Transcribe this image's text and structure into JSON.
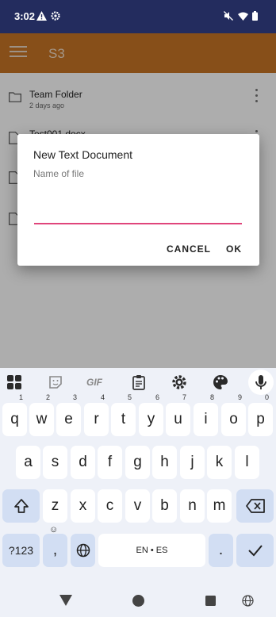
{
  "status": {
    "time": "3:02",
    "icons": [
      "warning-icon",
      "settings-icon",
      "mute-icon",
      "wifi-icon",
      "battery-icon"
    ]
  },
  "appbar": {
    "title": "S3",
    "menu_icon": "hamburger-menu-icon"
  },
  "files": [
    {
      "name": "Team Folder",
      "meta": "2 days ago",
      "icon": "folder-icon"
    },
    {
      "name": "Test001.docx",
      "meta": "",
      "icon": "file-icon"
    }
  ],
  "dialog": {
    "title": "New Text Document",
    "hint": "Name of file",
    "value": "",
    "cancel_label": "Cancel",
    "ok_label": "OK",
    "accent": "#e0457b"
  },
  "keyboard": {
    "toolbar": [
      "apps-icon",
      "sticker-icon",
      "gif-icon",
      "clipboard-icon",
      "settings-icon",
      "palette-icon",
      "mic-icon"
    ],
    "gif_label": "GIF",
    "row1": [
      {
        "key": "q",
        "hint": "1"
      },
      {
        "key": "w",
        "hint": "2"
      },
      {
        "key": "e",
        "hint": "3"
      },
      {
        "key": "r",
        "hint": "4"
      },
      {
        "key": "t",
        "hint": "5"
      },
      {
        "key": "y",
        "hint": "6"
      },
      {
        "key": "u",
        "hint": "7"
      },
      {
        "key": "i",
        "hint": "8"
      },
      {
        "key": "o",
        "hint": "9"
      },
      {
        "key": "p",
        "hint": "0"
      }
    ],
    "row2": [
      "a",
      "s",
      "d",
      "f",
      "g",
      "h",
      "j",
      "k",
      "l"
    ],
    "row3": [
      "z",
      "x",
      "c",
      "v",
      "b",
      "n",
      "m"
    ],
    "symbols_label": "?123",
    "comma": ",",
    "space_label": "EN • ES",
    "period": "."
  },
  "navbar": {
    "icons": [
      "back-icon",
      "home-icon",
      "recents-icon",
      "language-icon"
    ]
  }
}
